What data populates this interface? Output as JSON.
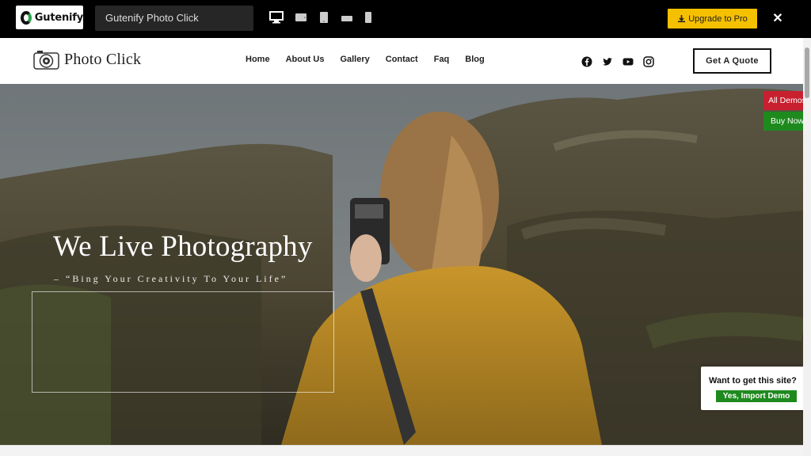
{
  "preview_bar": {
    "brand": "Gutenify",
    "demo_name": "Gutenify Photo Click",
    "devices": [
      "desktop-icon",
      "tablet-landscape-icon",
      "tablet-portrait-icon",
      "mobile-landscape-icon",
      "mobile-portrait-icon"
    ],
    "upgrade_label": "Upgrade to Pro",
    "close_label": "✕",
    "upgrade_color": "#f5c000"
  },
  "site_header": {
    "logo_text": "Photo Click",
    "nav": [
      "Home",
      "About Us",
      "Gallery",
      "Contact",
      "Faq",
      "Blog"
    ],
    "social": [
      "facebook-icon",
      "twitter-icon",
      "youtube-icon",
      "instagram-icon"
    ],
    "cta_label": "Get A Quote"
  },
  "hero": {
    "title": "We Live Photography",
    "subtitle": "– “Bing Your Creativity To Your Life”"
  },
  "side_buttons": {
    "all_demos": "All Demos",
    "buy_now": "Buy Now",
    "all_demos_color": "#c8202f",
    "buy_now_color": "#1e8a1e"
  },
  "import_popup": {
    "question": "Want to get this site?",
    "button_label": "Yes, Import Demo"
  }
}
